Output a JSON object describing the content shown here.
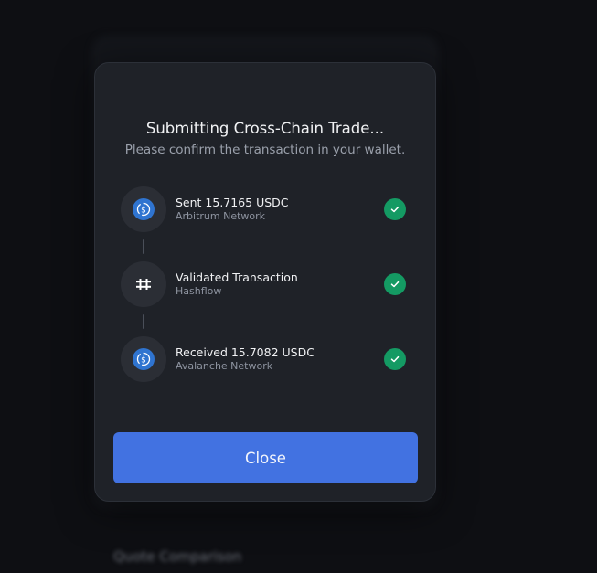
{
  "background": {
    "blurred_text": "Quote Comparison"
  },
  "modal": {
    "title": "Submitting Cross-Chain Trade...",
    "subtitle": "Please confirm the transaction in your wallet.",
    "steps": [
      {
        "title": "Sent 15.7165 USDC",
        "subtitle": "Arbitrum Network",
        "icon": "usdc-icon",
        "status": "complete"
      },
      {
        "title": "Validated Transaction",
        "subtitle": "Hashflow",
        "icon": "hashflow-icon",
        "status": "complete"
      },
      {
        "title": "Received 15.7082 USDC",
        "subtitle": "Avalanche Network",
        "icon": "usdc-icon",
        "status": "complete"
      }
    ],
    "close_label": "Close"
  },
  "colors": {
    "accent": "#4272e1",
    "success": "#149a63",
    "usdc": "#2f74d0",
    "modal_bg": "#1f2228"
  }
}
